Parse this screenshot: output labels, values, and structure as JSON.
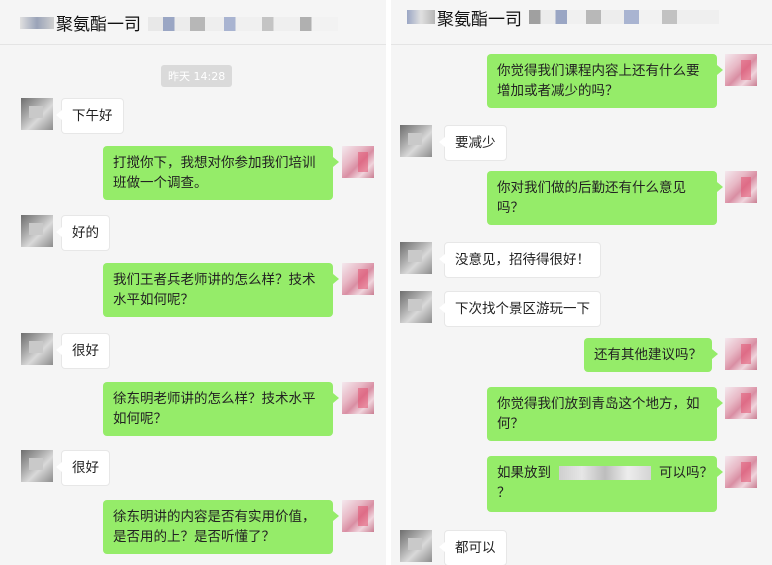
{
  "left": {
    "title": "聚氨酯一司",
    "timestamp": "昨天 14:28",
    "messages": [
      {
        "side": "in",
        "text": "下午好"
      },
      {
        "side": "out",
        "text": "打搅你下，我想对你参加我们培训班做一个调查。"
      },
      {
        "side": "in",
        "text": "好的"
      },
      {
        "side": "out",
        "text": "我们王者兵老师讲的怎么样？技术水平如何呢？"
      },
      {
        "side": "in",
        "text": "很好"
      },
      {
        "side": "out",
        "text": "徐东明老师讲的怎么样？技术水平如何呢？"
      },
      {
        "side": "in",
        "text": "很好"
      },
      {
        "side": "out",
        "text": "徐东明讲的内容是否有实用价值，是否用的上？是否听懂了？"
      }
    ]
  },
  "right": {
    "title": "聚氨酯一司",
    "messages": [
      {
        "side": "out",
        "text": "你觉得我们课程内容上还有什么要增加或者减少的吗？"
      },
      {
        "side": "in",
        "text": "要减少"
      },
      {
        "side": "out",
        "text": "你对我们做的后勤还有什么意见吗？"
      },
      {
        "side": "in",
        "text": "没意见，招待得很好！"
      },
      {
        "side": "in",
        "text": "下次找个景区游玩一下"
      },
      {
        "side": "out",
        "text": "还有其他建议吗？"
      },
      {
        "side": "out",
        "text": "你觉得我们放到青岛这个地方，如何？"
      },
      {
        "side": "out",
        "text": "如果放到",
        "text_suffix": "可以吗？"
      },
      {
        "side": "in",
        "text": "都可以"
      }
    ]
  },
  "colors": {
    "outgoing_bubble": "#95ec69",
    "incoming_bubble": "#ffffff",
    "background": "#f5f5f5"
  }
}
